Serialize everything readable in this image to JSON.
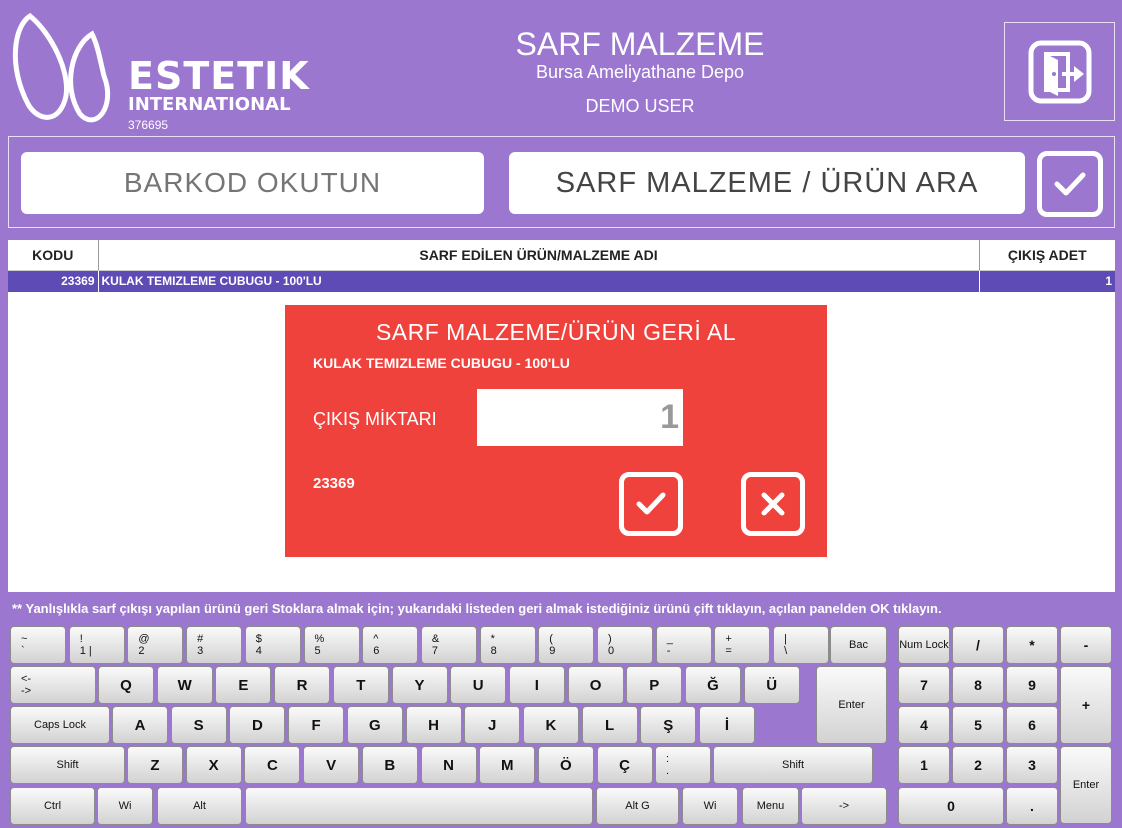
{
  "brand": {
    "name": "ESTETIK",
    "sub": "INTERNATIONAL",
    "code": "376695"
  },
  "header": {
    "title": "SARF MALZEME",
    "location": "Bursa Ameliyathane Depo",
    "user": "DEMO USER"
  },
  "search": {
    "barcode_placeholder": "BARKOD OKUTUN",
    "search_button": "SARF MALZEME / ÜRÜN ARA"
  },
  "table": {
    "headers": [
      "KODU",
      "SARF EDİLEN ÜRÜN/MALZEME ADI",
      "ÇIKIŞ ADET"
    ],
    "rows": [
      {
        "code": "23369",
        "name": "KULAK TEMIZLEME CUBUGU - 100'LU",
        "qty": "1"
      }
    ]
  },
  "dialog": {
    "title": "SARF MALZEME/ÜRÜN GERİ AL",
    "product": "KULAK TEMIZLEME CUBUGU - 100'LU",
    "qty_label": "ÇIKIŞ MİKTARI",
    "qty_value": "1",
    "code": "23369"
  },
  "hint": "** Yanlışlıkla sarf çıkışı yapılan ürünü geri Stoklara almak için; yukarıdaki listeden geri almak istediğiniz ürünü çift tıklayın, açılan panelden OK tıklayın.",
  "keyboard": {
    "row1": [
      [
        "~",
        "`"
      ],
      [
        "!",
        "1  |"
      ],
      [
        "@",
        "2"
      ],
      [
        "#",
        "3"
      ],
      [
        "$",
        "4"
      ],
      [
        "%",
        "5"
      ],
      [
        "^",
        "6"
      ],
      [
        "&",
        "7"
      ],
      [
        "*",
        "8"
      ],
      [
        "(",
        "9"
      ],
      [
        ")",
        "0"
      ],
      [
        "_",
        "-"
      ],
      [
        "+",
        "="
      ],
      [
        "|",
        "\\"
      ]
    ],
    "backspace": "Bac",
    "tab": [
      "<-",
      "->"
    ],
    "row2": [
      "Q",
      "W",
      "E",
      "R",
      "T",
      "Y",
      "U",
      "I",
      "O",
      "P",
      "Ğ",
      "Ü"
    ],
    "enter": "Enter",
    "caps": "Caps Lock",
    "row3": [
      "A",
      "S",
      "D",
      "F",
      "G",
      "H",
      "J",
      "K",
      "L",
      "Ş",
      "İ"
    ],
    "shift": "Shift",
    "row4": [
      "Z",
      "X",
      "C",
      "V",
      "B",
      "N",
      "M",
      "Ö",
      "Ç"
    ],
    "row4_extra": [
      ":",
      "."
    ],
    "ctrl": "Ctrl",
    "win": "Wi",
    "alt": "Alt",
    "altgr": "Alt G",
    "menu": "Menu",
    "arrow": "->",
    "numpad": {
      "numlock": "Num Lock",
      "top": [
        "/",
        "*",
        "-"
      ],
      "r1": [
        "7",
        "8",
        "9"
      ],
      "r2": [
        "4",
        "5",
        "6"
      ],
      "r3": [
        "1",
        "2",
        "3"
      ],
      "plus": "+",
      "zero": "0",
      "dot": ".",
      "enter": "Enter"
    }
  }
}
